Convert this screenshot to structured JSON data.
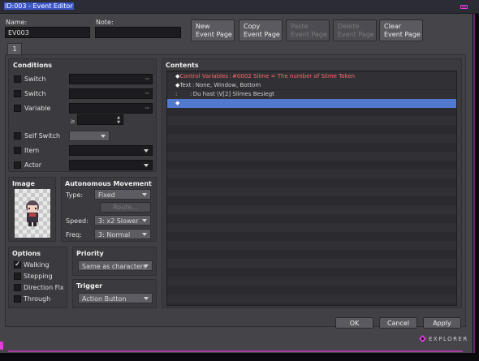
{
  "window": {
    "title": "ID:003 - Event Editor"
  },
  "header": {
    "name_label": "Name:",
    "name_value": "EV003",
    "note_label": "Note:",
    "note_value": "",
    "buttons": [
      {
        "line1": "New",
        "line2": "Event Page",
        "enabled": true
      },
      {
        "line1": "Copy",
        "line2": "Event Page",
        "enabled": true
      },
      {
        "line1": "Paste",
        "line2": "Event Page",
        "enabled": false
      },
      {
        "line1": "Delete",
        "line2": "Event Page",
        "enabled": false
      },
      {
        "line1": "Clear",
        "line2": "Event Page",
        "enabled": true
      }
    ]
  },
  "tabs": [
    "1"
  ],
  "conditions": {
    "title": "Conditions",
    "switch1": "Switch",
    "switch2": "Switch",
    "variable": "Variable",
    "ge": "≥",
    "self_switch": "Self Switch",
    "item": "Item",
    "actor": "Actor"
  },
  "image": {
    "title": "Image"
  },
  "autonomous": {
    "title": "Autonomous Movement",
    "type_label": "Type:",
    "type_value": "Fixed",
    "route_label": "Route...",
    "speed_label": "Speed:",
    "speed_value": "3: x2 Slower",
    "freq_label": "Freq:",
    "freq_value": "3: Normal"
  },
  "options": {
    "title": "Options",
    "items": [
      {
        "label": "Walking",
        "checked": true
      },
      {
        "label": "Stepping",
        "checked": false
      },
      {
        "label": "Direction Fix",
        "checked": false
      },
      {
        "label": "Through",
        "checked": false
      }
    ]
  },
  "priority": {
    "title": "Priority",
    "value": "Same as characters"
  },
  "trigger": {
    "title": "Trigger",
    "value": "Action Button"
  },
  "contents": {
    "title": "Contents",
    "lines": [
      {
        "prefix": "◆",
        "text": "Control Variables : #0002 Slime = The number of Slime Token",
        "color": "#ff6a6a"
      },
      {
        "prefix": "◆",
        "text": "Text : None, Window, Bottom",
        "color": "#d0d0d0"
      },
      {
        "prefix": ":",
        "text": "       : Du hast \\V[2] Slimes Besiegt",
        "color": "#d0d0d0"
      },
      {
        "prefix": "◆",
        "text": "",
        "color": "#ffffff"
      }
    ]
  },
  "footer": {
    "ok": "OK",
    "cancel": "Cancel",
    "apply": "Apply"
  },
  "brand": {
    "text": "EXPLORER",
    "accent": "#e83adf"
  }
}
